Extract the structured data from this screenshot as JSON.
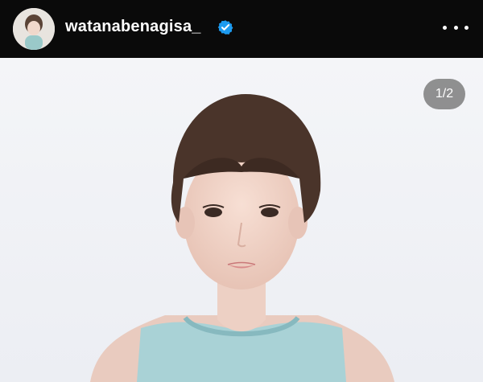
{
  "header": {
    "username": "watanabenagisa_",
    "verified_icon": "verified-badge-icon",
    "more_icon": "more-options-icon"
  },
  "post": {
    "counter": "1/2",
    "image_description_icon": "portrait-photo"
  },
  "colors": {
    "header_bg": "#0a0a0a",
    "photo_bg": "#f2f3f6",
    "verified_blue": "#1d9bf0",
    "counter_bg": "#6e6e6e"
  }
}
